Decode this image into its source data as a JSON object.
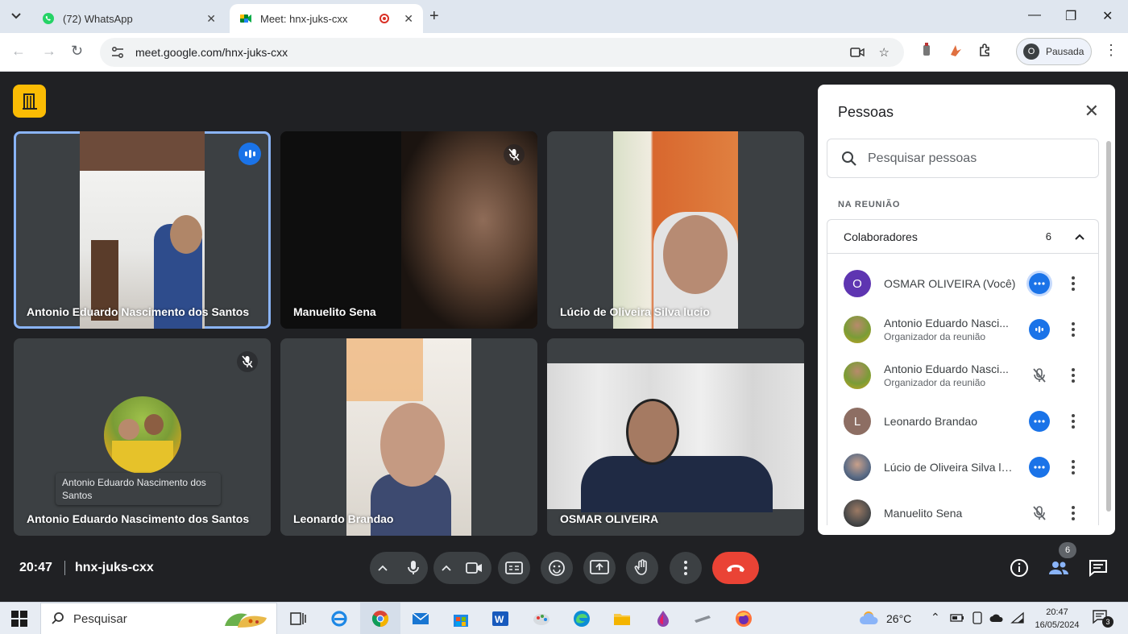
{
  "browser": {
    "tabs": [
      {
        "label": "(72) WhatsApp",
        "icon": "whatsapp-icon",
        "active": false
      },
      {
        "label": "Meet: hnx-juks-cxx",
        "icon": "google-meet-icon",
        "active": true
      }
    ],
    "url": "meet.google.com/hnx-juks-cxx",
    "profile": {
      "initial": "O",
      "label": "Pausada"
    }
  },
  "meet": {
    "tiles": [
      {
        "name": "Antonio Eduardo Nascimento dos Santos",
        "state": "speaking"
      },
      {
        "name": "Manuelito Sena",
        "state": "muted"
      },
      {
        "name": "Lúcio de Oliveira Silva lucio",
        "state": "none"
      },
      {
        "name": "Antonio Eduardo Nascimento dos Santos",
        "state": "muted",
        "tooltip": "Antonio Eduardo Nascimento dos Santos"
      },
      {
        "name": "Leonardo Brandao",
        "state": "none"
      },
      {
        "name": "OSMAR OLIVEIRA",
        "state": "none"
      }
    ],
    "panel": {
      "title": "Pessoas",
      "search_placeholder": "Pesquisar pessoas",
      "section": "NA REUNIÃO",
      "group_label": "Colaboradores",
      "group_count": "6",
      "people": [
        {
          "name": "OSMAR OLIVEIRA (Você)",
          "role": "",
          "initial": "O",
          "avatar_color": "#5e35b1",
          "status": "speaking"
        },
        {
          "name": "Antonio Eduardo Nasci...",
          "role": "Organizador da reunião",
          "initial": "",
          "avatar_color": "#8c6d3f",
          "status": "speaking"
        },
        {
          "name": "Antonio Eduardo Nasci...",
          "role": "Organizador da reunião",
          "initial": "",
          "avatar_color": "#8c6d3f",
          "status": "muted"
        },
        {
          "name": "Leonardo Brandao",
          "role": "",
          "initial": "L",
          "avatar_color": "#8d6e63",
          "status": "speaking"
        },
        {
          "name": "Lúcio de Oliveira Silva lu...",
          "role": "",
          "initial": "",
          "avatar_color": "#5a6b85",
          "status": "speaking"
        },
        {
          "name": "Manuelito Sena",
          "role": "",
          "initial": "",
          "avatar_color": "#4a4a4a",
          "status": "muted"
        }
      ]
    },
    "footer": {
      "time": "20:47",
      "meeting_code": "hnx-juks-cxx",
      "people_badge": "6"
    }
  },
  "taskbar": {
    "search_label": "Pesquisar",
    "weather": "26°C",
    "time": "20:47",
    "date": "16/05/2024",
    "notifications": "3"
  }
}
